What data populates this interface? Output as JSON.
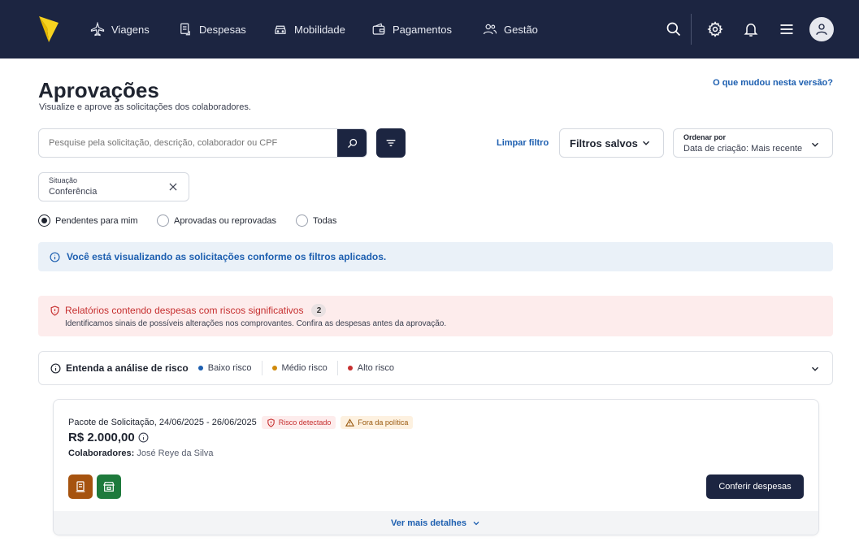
{
  "nav": {
    "items": [
      {
        "label": "Viagens",
        "icon": "airplane-icon"
      },
      {
        "label": "Despesas",
        "icon": "receipt-icon"
      },
      {
        "label": "Mobilidade",
        "icon": "car-icon"
      },
      {
        "label": "Pagamentos",
        "icon": "wallet-icon"
      },
      {
        "label": "Gestão",
        "icon": "users-icon"
      }
    ],
    "right_icons": [
      "search-icon",
      "gear-icon",
      "bell-icon",
      "menu-icon",
      "avatar-icon"
    ],
    "background": "#1c2541"
  },
  "header": {
    "title": "Aprovações",
    "subtitle": "Visualize e aprove as solicitações dos colaboradores.",
    "whats_new": "O que mudou nesta versão?"
  },
  "search": {
    "placeholder": "Pesquise pela solicitação, descrição, colaborador ou CPF",
    "clear_filter": "Limpar filtro",
    "saved_filters": "Filtros salvos",
    "sort_label": "Ordenar por",
    "sort_value": "Data de criação: Mais recente"
  },
  "chip": {
    "label": "Situação",
    "value": "Conferência"
  },
  "radios": [
    {
      "label": "Pendentes para mim",
      "checked": true
    },
    {
      "label": "Aprovadas ou reprovadas",
      "checked": false
    },
    {
      "label": "Todas",
      "checked": false
    }
  ],
  "info_banner": "Você está visualizando as solicitações conforme os filtros aplicados.",
  "risk_alert": {
    "title": "Relatórios contendo despesas com riscos significativos",
    "count": "2",
    "description": "Identificamos sinais de possíveis alterações nos comprovantes. Confira as despesas antes da aprovação."
  },
  "analysis": {
    "title": "Entenda a análise de risco",
    "legend": [
      {
        "label": "Baixo risco",
        "color": "#1d5fb0"
      },
      {
        "label": "Médio risco",
        "color": "#d08a0b"
      },
      {
        "label": "Alto risco",
        "color": "#c62f2f"
      }
    ]
  },
  "card": {
    "title": "Pacote de Solicitação, 24/06/2025 - 26/06/2025",
    "badge_risk": "Risco detectado",
    "badge_policy": "Fora da política",
    "amount": "R$ 2.000,00",
    "collaborators_label": "Colaboradores:",
    "collaborators_value": "José Reye da Silva",
    "type_icons": [
      {
        "icon": "receipt-icon",
        "color": "#a6530f"
      },
      {
        "icon": "store-icon",
        "color": "#1e7a3c"
      }
    ],
    "action": "Conferir despesas",
    "more_details": "Ver mais detalhes"
  }
}
